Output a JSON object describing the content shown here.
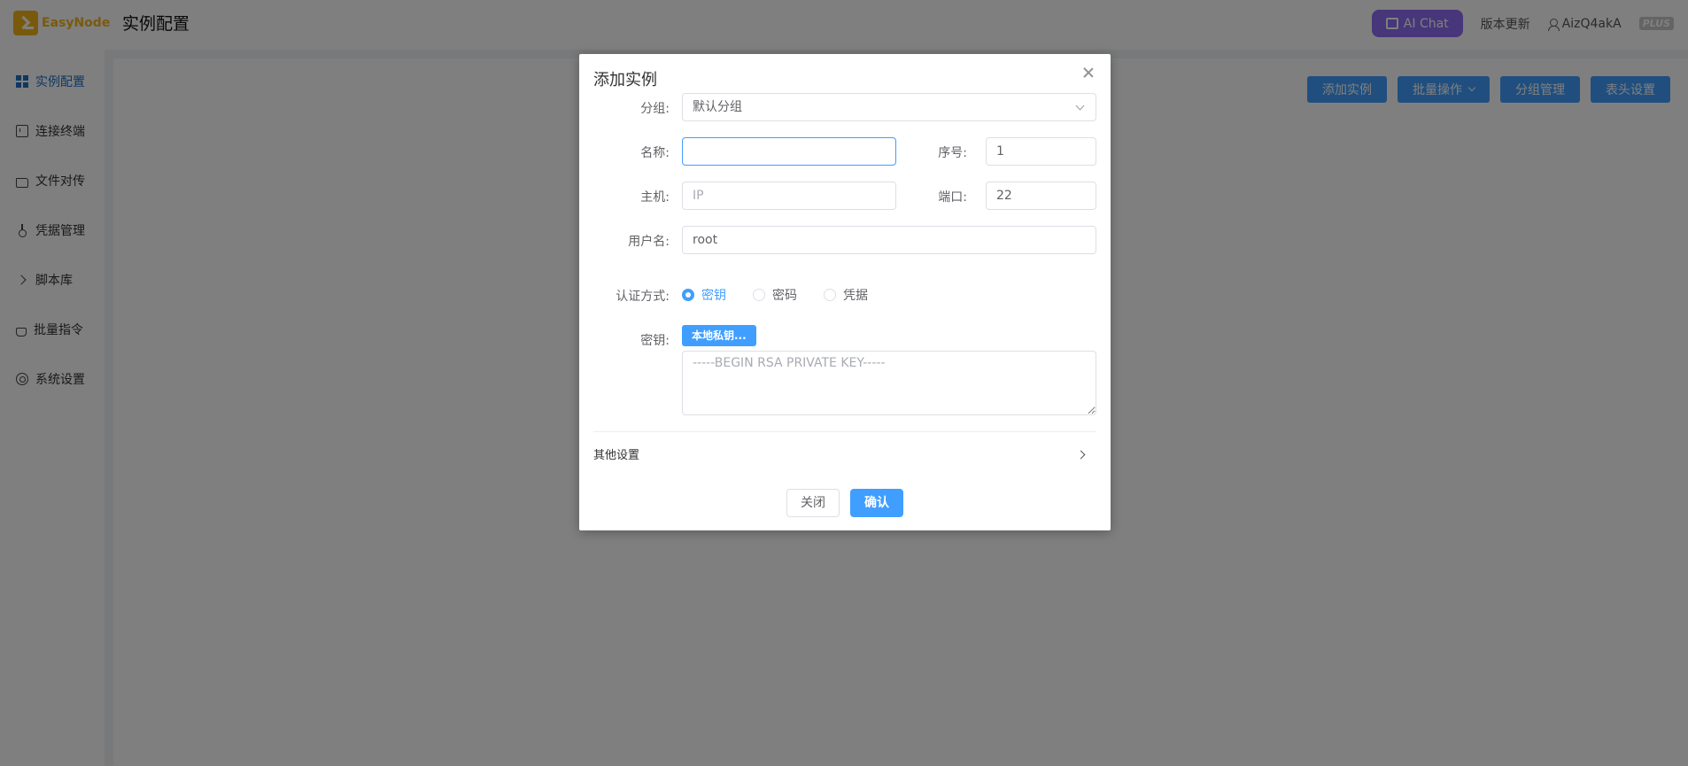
{
  "app": {
    "logo_text": "EasyNode",
    "page_title": "实例配置"
  },
  "header": {
    "ai_chat_label": "AI Chat",
    "update_label": "版本更新",
    "username": "AizQ4akA",
    "plan_badge": "PLUS"
  },
  "sidebar": {
    "items": [
      {
        "label": "实例配置",
        "icon": "grid-icon",
        "active": true
      },
      {
        "label": "连接终端",
        "icon": "terminal-icon"
      },
      {
        "label": "文件对传",
        "icon": "folder-icon"
      },
      {
        "label": "凭据管理",
        "icon": "key-icon"
      },
      {
        "label": "脚本库",
        "icon": "chevron-right-icon"
      },
      {
        "label": "批量指令",
        "icon": "hand-icon"
      },
      {
        "label": "系统设置",
        "icon": "gear-icon"
      }
    ]
  },
  "toolbar": {
    "add_label": "添加实例",
    "batch_label": "批量操作",
    "group_label": "分组管理",
    "header_label": "表头设置"
  },
  "dialog": {
    "title": "添加实例",
    "group_label": "分组:",
    "group_value": "默认分组",
    "name_label": "名称:",
    "name_value": "",
    "index_label": "序号:",
    "index_value": "1",
    "host_label": "主机:",
    "host_placeholder": "IP",
    "port_label": "端口:",
    "port_value": "22",
    "username_label": "用户名:",
    "username_value": "root",
    "auth_label": "认证方式:",
    "auth_options": [
      "密钥",
      "密码",
      "凭据"
    ],
    "auth_selected": "密钥",
    "key_label": "密钥:",
    "local_key_button": "本地私钥...",
    "key_placeholder": "-----BEGIN RSA PRIVATE KEY-----",
    "other_settings_label": "其他设置",
    "close_label": "关闭",
    "confirm_label": "确认"
  },
  "colors": {
    "primary": "#409eff",
    "ai_chat": "#8e6cf5",
    "logo": "#f2b51b",
    "sidebar_active": "#1f6fc5"
  }
}
